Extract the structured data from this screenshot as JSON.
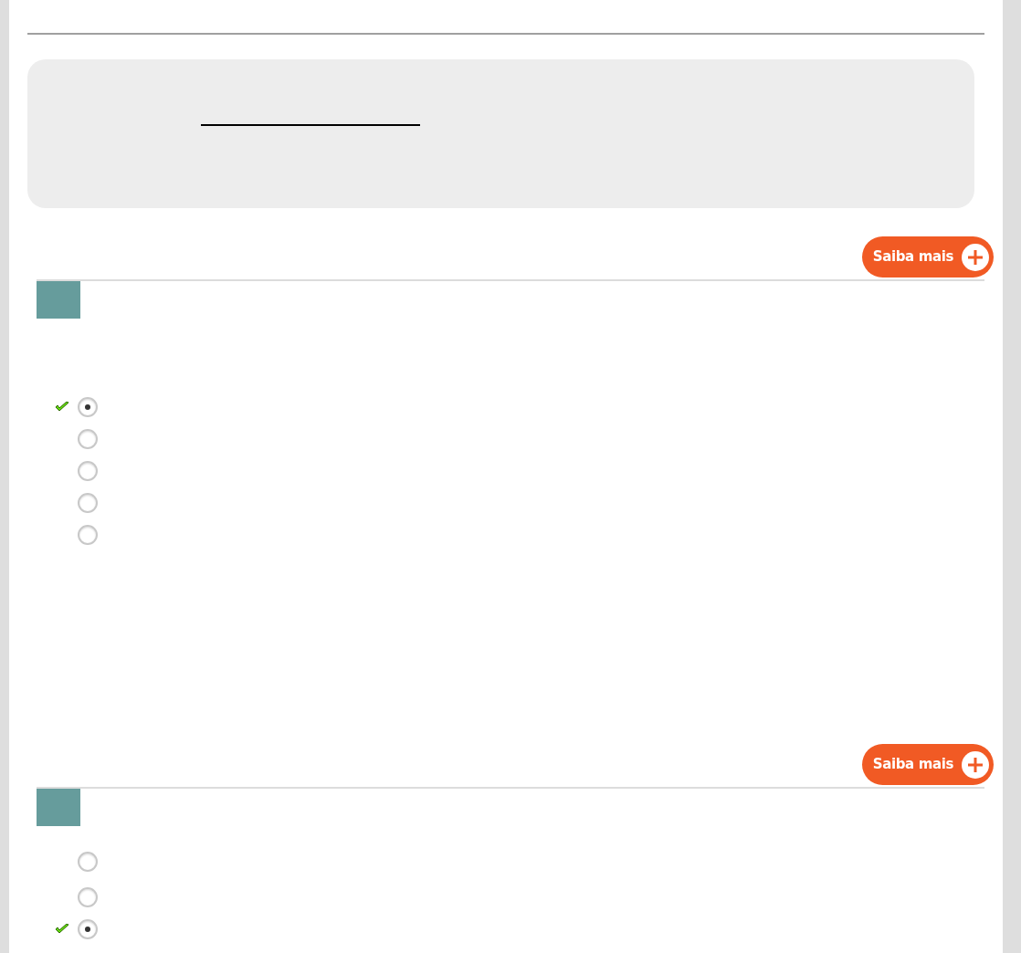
{
  "questions": [
    {
      "more_button": "Saiba mais",
      "options": [
        {
          "selected": true,
          "correct": true
        },
        {
          "selected": false,
          "correct": false
        },
        {
          "selected": false,
          "correct": false
        },
        {
          "selected": false,
          "correct": false
        },
        {
          "selected": false,
          "correct": false
        }
      ]
    },
    {
      "more_button": "Saiba mais",
      "options": [
        {
          "selected": false,
          "correct": false
        },
        {
          "selected": false,
          "correct": false
        },
        {
          "selected": true,
          "correct": true
        }
      ]
    }
  ]
}
